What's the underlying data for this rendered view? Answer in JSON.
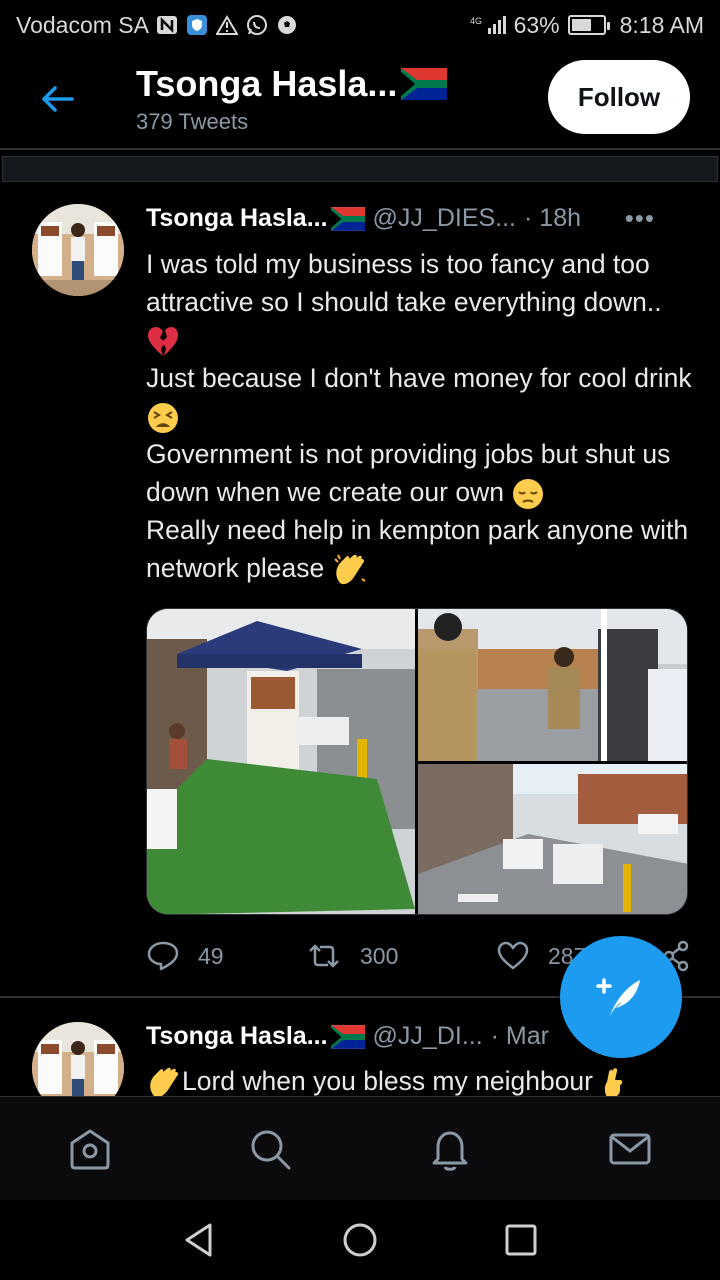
{
  "status_bar": {
    "carrier": "Vodacom SA",
    "network": "4G",
    "battery": "63%",
    "battery_level": 0.63,
    "time": "8:18 AM"
  },
  "header": {
    "title": "Tsonga Hasla...",
    "tweet_count": "379 Tweets",
    "follow_label": "Follow"
  },
  "tweets": [
    {
      "name": "Tsonga Hasla...",
      "handle": "@JJ_DIES...",
      "time": "· 18h",
      "lines": [
        "I was told my business is too fancy and too attractive so I should take everything down..",
        "Just because I don't have money for cool drink",
        "Government is not providing jobs but shut us down when we create our own",
        "Really need help in kempton park anyone with network please "
      ],
      "replies": "49",
      "retweets": "300",
      "likes": "287"
    },
    {
      "name": "Tsonga Hasla...",
      "handle": "@JJ_DI...",
      "time": "· Mar",
      "text": "Lord when you bless my neighbour "
    }
  ],
  "colors": {
    "accent": "#1d9bf0",
    "background": "#000000",
    "secondary_text": "#8b98a5"
  }
}
